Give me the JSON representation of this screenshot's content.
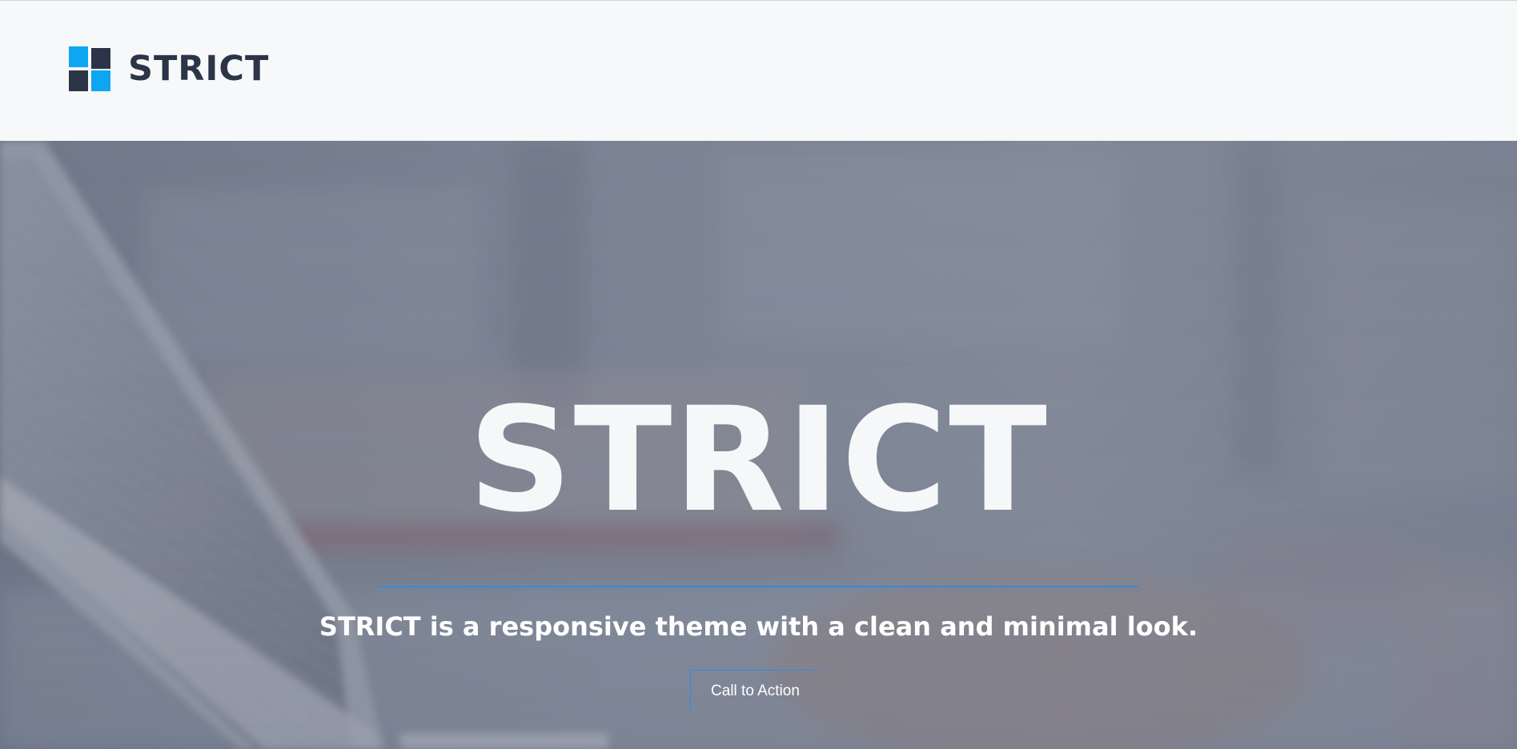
{
  "header": {
    "logo_text": "STRICT",
    "logo_colors": {
      "accent": "#0ea5f2",
      "dark": "#2c3547"
    }
  },
  "hero": {
    "title": "STRICT",
    "subtitle": "STRICT is a responsive theme with a clean and minimal look.",
    "cta_label": "Call to Action",
    "accent_color": "#2f8ce0",
    "background_image": "blurred-laptop-typing-photo"
  }
}
